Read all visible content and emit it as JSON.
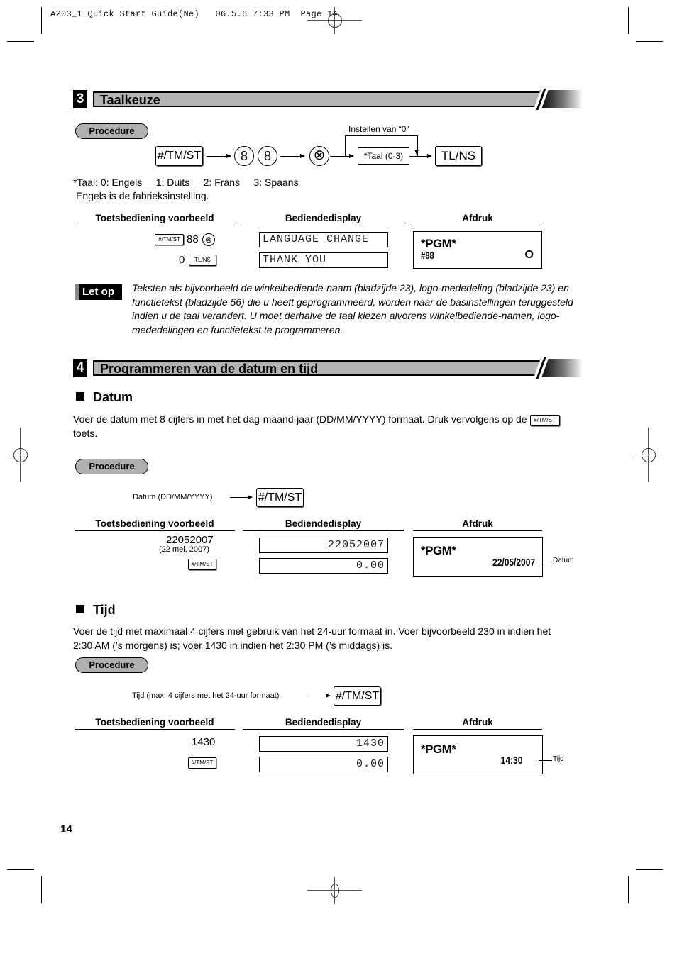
{
  "slug_line": "A203_1 Quick Start Guide(Ne)   06.5.6 7:33 PM  Page 14",
  "section3": {
    "number": "3",
    "title": "Taalkeuze",
    "procedure_label": "Procedure",
    "flow": {
      "key_tmst": "#/TM/ST",
      "digit1": "8",
      "digit2": "8",
      "multiply_symbol": "⊗",
      "taal_box": "*Taal (0-3)",
      "bypass_label": "Instellen van “0”",
      "key_tlns": "TL/NS"
    },
    "footnote_line1": "*Taal: 0: Engels     1: Duits     2: Frans     3: Spaans",
    "footnote_line2": "Engels is de fabrieksinstelling.",
    "columns": {
      "keys": "Toetsbediening voorbeeld",
      "display": "Bediendedisplay",
      "print": "Afdruk"
    },
    "rows": [
      {
        "key_label": "#/TM/ST",
        "entry": "88",
        "symbol": "⊗",
        "display": "LANGUAGE CHANGE"
      },
      {
        "entry": "0",
        "key_label": "TL/NS",
        "display": "THANK YOU"
      }
    ],
    "printout": {
      "header": "*PGM*",
      "code": "#88",
      "value": "O"
    },
    "note_label": "Let op",
    "note_text": "Teksten als bijvoorbeeld de winkelbediende-naam (bladzijde 23), logo-mededeling (bladzijde 23) en functietekst (bladzijde 56) die u heeft geprogrammeerd, worden naar de basinstellingen teruggesteld indien u de taal verandert. U moet derhalve de taal kiezen alvorens winkelbediende-namen, logo-mededelingen en functietekst te programmeren."
  },
  "section4": {
    "number": "4",
    "title": "Programmeren van de datum en tijd",
    "datum": {
      "heading": "Datum",
      "body_pre": "Voer de datum met 8 cijfers in met het dag-maand-jaar (DD/MM/YYYY) formaat. Druk vervolgens op de",
      "body_key": "#/TM/ST",
      "body_post": "toets.",
      "procedure_label": "Procedure",
      "flow_label": "Datum (DD/MM/YYYY)",
      "flow_key": "#/TM/ST",
      "columns": {
        "keys": "Toetsbediening voorbeeld",
        "display": "Bediendedisplay",
        "print": "Afdruk"
      },
      "entry": "22052007",
      "entry_note": "(22 mei, 2007)",
      "entry_key": "#/TM/ST",
      "display1": "22052007",
      "display2": "0.00",
      "printout": {
        "header": "*PGM*",
        "value": "22/05/2007",
        "callout": "Datum"
      }
    },
    "tijd": {
      "heading": "Tijd",
      "body_line1": "Voer de tijd met maximaal 4 cijfers met gebruik van het 24-uur formaat in. Voer bijvoorbeeld 230 in indien het",
      "body_line2": "2:30 AM (’s morgens) is; voer 1430 in indien het 2:30 PM (’s middags) is.",
      "procedure_label": "Procedure",
      "flow_label": "Tijd (max. 4 cijfers met het 24-uur formaat)",
      "flow_key": "#/TM/ST",
      "columns": {
        "keys": "Toetsbediening voorbeeld",
        "display": "Bediendedisplay",
        "print": "Afdruk"
      },
      "entry": "1430",
      "entry_key": "#/TM/ST",
      "display1": "1430",
      "display2": "0.00",
      "printout": {
        "header": "*PGM*",
        "value": "14:30",
        "callout": "Tijd"
      }
    }
  },
  "page_number": "14"
}
